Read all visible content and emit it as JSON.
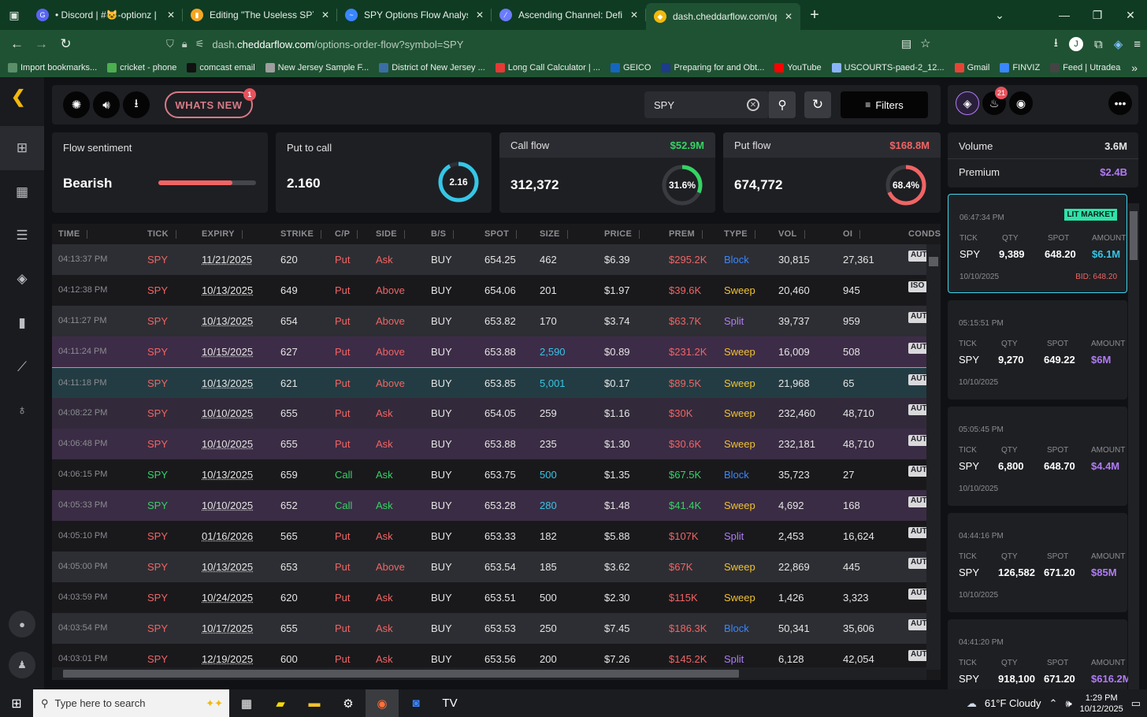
{
  "browser": {
    "tabs": [
      {
        "title": "• Discord | #😺-optionz | The U",
        "color": "#5865f2",
        "glyph": "G"
      },
      {
        "title": "Editing \"The Useless SPY report",
        "color": "#f5a623",
        "glyph": "▮"
      },
      {
        "title": "SPY Options Flow Analysis - Rea",
        "color": "#3a86ff",
        "glyph": "~"
      },
      {
        "title": "Ascending Channel: Definition,",
        "color": "#6b7cff",
        "glyph": "⁄"
      },
      {
        "title": "dash.cheddarflow.com/options-",
        "color": "#f2b90c",
        "glyph": "◆"
      }
    ],
    "url_prefix": "dash.",
    "url_domain": "cheddarflow.com",
    "url_path": "/options-order-flow?symbol=SPY",
    "bookmarks": [
      {
        "label": "Import bookmarks...",
        "color": "#5a8f6a"
      },
      {
        "label": "cricket - phone",
        "color": "#4caf50"
      },
      {
        "label": "comcast email",
        "color": "#111111"
      },
      {
        "label": "New Jersey Sample F...",
        "color": "#9e9e9e"
      },
      {
        "label": "District of New Jersey ...",
        "color": "#3a6ea5"
      },
      {
        "label": "Long Call Calculator | ...",
        "color": "#e53935"
      },
      {
        "label": "GEICO",
        "color": "#1565c0"
      },
      {
        "label": "Preparing for and Obt...",
        "color": "#1e3a8a"
      },
      {
        "label": "YouTube",
        "color": "#ff0000"
      },
      {
        "label": "USCOURTS-paed-2_12...",
        "color": "#8ab4f8"
      },
      {
        "label": "Gmail",
        "color": "#ea4335"
      },
      {
        "label": "FINVIZ",
        "color": "#3a86ff"
      },
      {
        "label": "Feed | Utradea",
        "color": "#444444"
      }
    ]
  },
  "topbar": {
    "whats_new": "WHATS NEW",
    "whats_new_badge": "1",
    "search_value": "SPY",
    "filters_label": "Filters"
  },
  "stats": {
    "sentiment": {
      "label": "Flow sentiment",
      "value": "Bearish",
      "bar_fraction": 0.76
    },
    "put_to_call": {
      "label": "Put to call",
      "value": "2.160",
      "ring_text": "2.16",
      "ring_fraction": 0.92
    },
    "call_flow": {
      "label": "Call flow",
      "amount": "$52.9M",
      "count": "312,372",
      "pct_text": "31.6%",
      "pct": 0.316
    },
    "put_flow": {
      "label": "Put flow",
      "amount": "$168.8M",
      "count": "674,772",
      "pct_text": "68.4%",
      "pct": 0.684
    }
  },
  "table": {
    "headers": [
      "TIME",
      "TICK",
      "EXPIRY",
      "STRIKE",
      "C/P",
      "SIDE",
      "B/S",
      "SPOT",
      "SIZE",
      "PRICE",
      "PREM",
      "TYPE",
      "VOL",
      "OI",
      "CONDS"
    ],
    "rows": [
      {
        "time": "04:13:37 PM",
        "tick": "SPY",
        "expiry": "11/21/2025",
        "strike": "620",
        "cp": "Put",
        "side": "Ask",
        "bs": "BUY",
        "spot": "654.25",
        "size": "462",
        "price": "$6.39",
        "prem": "$295.2K",
        "type": "Block",
        "vol": "30,815",
        "oi": "27,361",
        "cond": "AUTO",
        "bg": "#2d2e33"
      },
      {
        "time": "04:12:38 PM",
        "tick": "SPY",
        "expiry": "10/13/2025",
        "strike": "649",
        "cp": "Put",
        "side": "Above",
        "bs": "BUY",
        "spot": "654.06",
        "size": "201",
        "price": "$1.97",
        "prem": "$39.6K",
        "type": "Sweep",
        "vol": "20,460",
        "oi": "945",
        "cond": "ISO",
        "bg": "#19191c"
      },
      {
        "time": "04:11:27 PM",
        "tick": "SPY",
        "expiry": "10/13/2025",
        "strike": "654",
        "cp": "Put",
        "side": "Above",
        "bs": "BUY",
        "spot": "653.82",
        "size": "170",
        "price": "$3.74",
        "prem": "$63.7K",
        "type": "Split",
        "vol": "39,737",
        "oi": "959",
        "cond": "AUTO",
        "bg": "#2d2e33"
      },
      {
        "time": "04:11:24 PM",
        "tick": "SPY",
        "expiry": "10/15/2025",
        "strike": "627",
        "cp": "Put",
        "side": "Above",
        "bs": "BUY",
        "spot": "653.88",
        "size": "2,590",
        "price": "$0.89",
        "prem": "$231.2K",
        "type": "Sweep",
        "vol": "16,009",
        "oi": "508",
        "cond": "AUTO",
        "bg": "#3d2c47",
        "big": true
      },
      {
        "time": "04:11:18 PM",
        "tick": "SPY",
        "expiry": "10/13/2025",
        "strike": "621",
        "cp": "Put",
        "side": "Above",
        "bs": "BUY",
        "spot": "653.85",
        "size": "5,001",
        "price": "$0.17",
        "prem": "$89.5K",
        "type": "Sweep",
        "vol": "21,968",
        "oi": "65",
        "cond": "AUTO",
        "bg": "#233c43",
        "big": true
      },
      {
        "time": "04:08:22 PM",
        "tick": "SPY",
        "expiry": "10/10/2025",
        "strike": "655",
        "cp": "Put",
        "side": "Ask",
        "bs": "BUY",
        "spot": "654.05",
        "size": "259",
        "price": "$1.16",
        "prem": "$30K",
        "type": "Sweep",
        "vol": "232,460",
        "oi": "48,710",
        "cond": "AUTO",
        "bg": "#322a3a"
      },
      {
        "time": "04:06:48 PM",
        "tick": "SPY",
        "expiry": "10/10/2025",
        "strike": "655",
        "cp": "Put",
        "side": "Ask",
        "bs": "BUY",
        "spot": "653.88",
        "size": "235",
        "price": "$1.30",
        "prem": "$30.6K",
        "type": "Sweep",
        "vol": "232,181",
        "oi": "48,710",
        "cond": "AUTO",
        "bg": "#3a2c44"
      },
      {
        "time": "04:06:15 PM",
        "tick": "SPY",
        "expiry": "10/13/2025",
        "strike": "659",
        "cp": "Call",
        "side": "Ask",
        "bs": "BUY",
        "spot": "653.75",
        "size": "500",
        "price": "$1.35",
        "prem": "$67.5K",
        "type": "Block",
        "vol": "35,723",
        "oi": "27",
        "cond": "AUTO",
        "bg": "#19191c",
        "big": true
      },
      {
        "time": "04:05:33 PM",
        "tick": "SPY",
        "expiry": "10/10/2025",
        "strike": "652",
        "cp": "Call",
        "side": "Ask",
        "bs": "BUY",
        "spot": "653.28",
        "size": "280",
        "price": "$1.48",
        "prem": "$41.4K",
        "type": "Sweep",
        "vol": "4,692",
        "oi": "168",
        "cond": "AUTO",
        "bg": "#3a2c44",
        "big": true
      },
      {
        "time": "04:05:10 PM",
        "tick": "SPY",
        "expiry": "01/16/2026",
        "strike": "565",
        "cp": "Put",
        "side": "Ask",
        "bs": "BUY",
        "spot": "653.33",
        "size": "182",
        "price": "$5.88",
        "prem": "$107K",
        "type": "Split",
        "vol": "2,453",
        "oi": "16,624",
        "cond": "AUTO",
        "bg": "#19191c"
      },
      {
        "time": "04:05:00 PM",
        "tick": "SPY",
        "expiry": "10/13/2025",
        "strike": "653",
        "cp": "Put",
        "side": "Above",
        "bs": "BUY",
        "spot": "653.54",
        "size": "185",
        "price": "$3.62",
        "prem": "$67K",
        "type": "Sweep",
        "vol": "22,869",
        "oi": "445",
        "cond": "AUTO",
        "bg": "#2d2e33"
      },
      {
        "time": "04:03:59 PM",
        "tick": "SPY",
        "expiry": "10/24/2025",
        "strike": "620",
        "cp": "Put",
        "side": "Ask",
        "bs": "BUY",
        "spot": "653.51",
        "size": "500",
        "price": "$2.30",
        "prem": "$115K",
        "type": "Sweep",
        "vol": "1,426",
        "oi": "3,323",
        "cond": "AUTO",
        "bg": "#19191c"
      },
      {
        "time": "04:03:54 PM",
        "tick": "SPY",
        "expiry": "10/17/2025",
        "strike": "655",
        "cp": "Put",
        "side": "Ask",
        "bs": "BUY",
        "spot": "653.53",
        "size": "250",
        "price": "$7.45",
        "prem": "$186.3K",
        "type": "Block",
        "vol": "50,341",
        "oi": "35,606",
        "cond": "AUTO",
        "bg": "#2d2e33"
      },
      {
        "time": "04:03:01 PM",
        "tick": "SPY",
        "expiry": "12/19/2025",
        "strike": "600",
        "cp": "Put",
        "side": "Ask",
        "bs": "BUY",
        "spot": "653.56",
        "size": "200",
        "price": "$7.26",
        "prem": "$145.2K",
        "type": "Split",
        "vol": "6,128",
        "oi": "42,054",
        "cond": "AUTO",
        "bg": "#19191c"
      }
    ]
  },
  "right_panel": {
    "notif_badge": "21",
    "volume_label": "Volume",
    "volume_value": "3.6M",
    "premium_label": "Premium",
    "premium_value": "$2.4B",
    "labels": {
      "tick": "TICK",
      "qty": "QTY",
      "spot": "SPOT",
      "amount": "AMOUNT"
    },
    "trades": [
      {
        "time": "06:47:34 PM",
        "tag": "LIT MARKET",
        "tick": "SPY",
        "qty": "9,389",
        "spot": "648.20",
        "amount": "$6.1M",
        "amount_color": "#35c6e7",
        "date": "10/10/2025",
        "bid": "BID: 648.20"
      },
      {
        "time": "05:15:51 PM",
        "tick": "SPY",
        "qty": "9,270",
        "spot": "649.22",
        "amount": "$6M",
        "amount_color": "#b07cf5",
        "date": "10/10/2025"
      },
      {
        "time": "05:05:45 PM",
        "tick": "SPY",
        "qty": "6,800",
        "spot": "648.70",
        "amount": "$4.4M",
        "amount_color": "#b07cf5",
        "date": "10/10/2025"
      },
      {
        "time": "04:44:16 PM",
        "tick": "SPY",
        "qty": "126,582",
        "spot": "671.20",
        "amount": "$85M",
        "amount_color": "#b07cf5",
        "date": "10/10/2025"
      },
      {
        "time": "04:41:20 PM",
        "tick": "SPY",
        "qty": "918,100",
        "spot": "671.20",
        "amount": "$616.2M",
        "amount_color": "#b07cf5"
      }
    ]
  },
  "taskbar": {
    "search_placeholder": "Type here to search",
    "weather": "61°F  Cloudy",
    "time": "1:29 PM",
    "date": "10/12/2025"
  }
}
